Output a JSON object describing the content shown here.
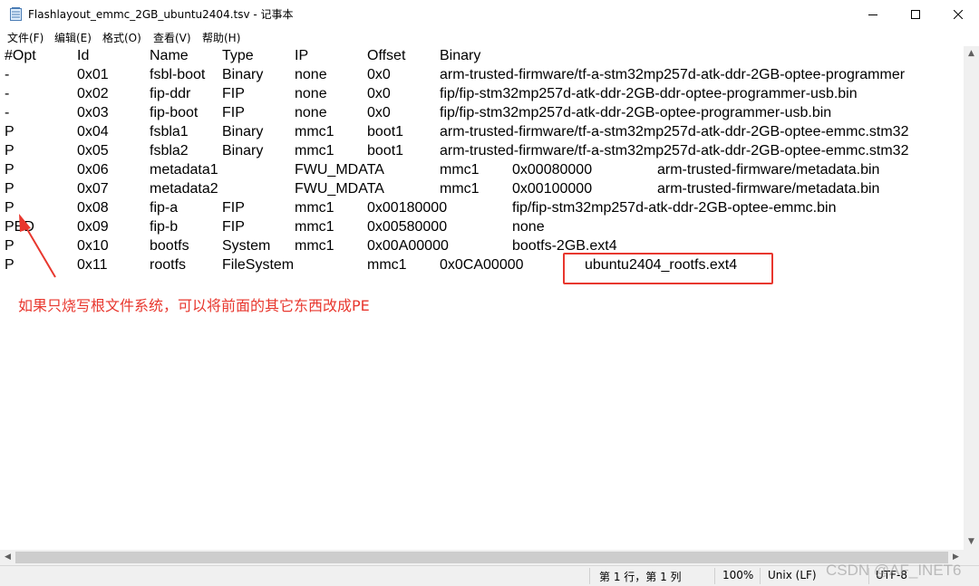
{
  "window": {
    "title": "Flashlayout_emmc_2GB_ubuntu2404.tsv - 记事本",
    "minimize_icon": "minimize-icon",
    "maximize_icon": "maximize-icon",
    "close_icon": "close-icon"
  },
  "menu": [
    "文件(F)",
    "编辑(E)",
    "格式(O)",
    "查看(V)",
    "帮助(H)"
  ],
  "lines": [
    [
      "#Opt",
      "Id",
      "Name",
      "Type",
      "IP",
      "Offset",
      "Binary"
    ],
    [
      "-",
      "0x01",
      "fsbl-boot",
      "Binary",
      "none",
      "0x0",
      "arm-trusted-firmware/tf-a-stm32mp257d-atk-ddr-2GB-optee-programmer"
    ],
    [
      "-",
      "0x02",
      "fip-ddr",
      "FIP",
      "none",
      "0x0",
      "fip/fip-stm32mp257d-atk-ddr-2GB-ddr-optee-programmer-usb.bin"
    ],
    [
      "-",
      "0x03",
      "fip-boot",
      "FIP",
      "none",
      "0x0",
      "fip/fip-stm32mp257d-atk-ddr-2GB-optee-programmer-usb.bin"
    ],
    [
      "P",
      "0x04",
      "fsbla1",
      "Binary",
      "mmc1",
      "boot1",
      "arm-trusted-firmware/tf-a-stm32mp257d-atk-ddr-2GB-optee-emmc.stm32"
    ],
    [
      "P",
      "0x05",
      "fsbla2",
      "Binary",
      "mmc1",
      "boot1",
      "arm-trusted-firmware/tf-a-stm32mp257d-atk-ddr-2GB-optee-emmc.stm32"
    ],
    [
      "P",
      "0x06",
      "metadata1",
      "",
      "FWU_MDATA",
      "",
      "mmc1",
      "0x00080000",
      "",
      "arm-trusted-firmware/metadata.bin"
    ],
    [
      "P",
      "0x07",
      "metadata2",
      "",
      "FWU_MDATA",
      "",
      "mmc1",
      "0x00100000",
      "",
      "arm-trusted-firmware/metadata.bin"
    ],
    [
      "P",
      "0x08",
      "fip-a",
      "FIP",
      "mmc1",
      "0x00180000",
      "",
      "fip/fip-stm32mp257d-atk-ddr-2GB-optee-emmc.bin"
    ],
    [
      "PED",
      "0x09",
      "fip-b",
      "FIP",
      "mmc1",
      "0x00580000",
      "",
      "none"
    ],
    [
      "P",
      "0x10",
      "bootfs",
      "System",
      "mmc1",
      "0x00A00000",
      "",
      "bootfs-2GB.ext4"
    ],
    [
      "P",
      "0x11",
      "rootfs",
      "FileSystem",
      "",
      "mmc1",
      "0x0CA00000",
      "",
      "ubuntu2404_rootfs.ext4"
    ]
  ],
  "annotation": {
    "note": "如果只烧写根文件系统，可以将前面的其它东西改成PE",
    "color": "#e8372e"
  },
  "status": {
    "position": "第 1 行，第 1 列",
    "zoom": "100%",
    "line_ending": "Unix (LF)",
    "encoding": "UTF-8"
  },
  "watermark": "CSDN @AF_INET6"
}
